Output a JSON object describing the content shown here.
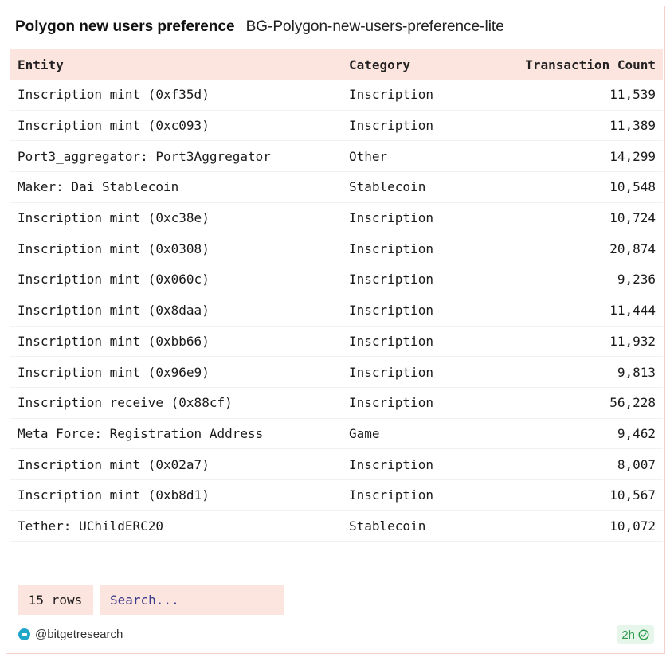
{
  "header": {
    "title": "Polygon new users preference",
    "subtitle": "BG-Polygon-new-users-preference-lite"
  },
  "table": {
    "columns": [
      "Entity",
      "Category",
      "Transaction Count"
    ],
    "rows": [
      [
        "Inscription mint (0xf35d)",
        "Inscription",
        "11,539"
      ],
      [
        "Inscription mint (0xc093)",
        "Inscription",
        "11,389"
      ],
      [
        "Port3_aggregator: Port3Aggregator",
        "Other",
        "14,299"
      ],
      [
        "Maker: Dai Stablecoin",
        "Stablecoin",
        "10,548"
      ],
      [
        "Inscription mint (0xc38e)",
        "Inscription",
        "10,724"
      ],
      [
        "Inscription mint (0x0308)",
        "Inscription",
        "20,874"
      ],
      [
        "Inscription mint (0x060c)",
        "Inscription",
        "9,236"
      ],
      [
        "Inscription mint (0x8daa)",
        "Inscription",
        "11,444"
      ],
      [
        "Inscription mint (0xbb66)",
        "Inscription",
        "11,932"
      ],
      [
        "Inscription mint (0x96e9)",
        "Inscription",
        "9,813"
      ],
      [
        "Inscription receive (0x88cf)",
        "Inscription",
        "56,228"
      ],
      [
        "Meta Force: Registration Address",
        "Game",
        "9,462"
      ],
      [
        "Inscription mint (0x02a7)",
        "Inscription",
        "8,007"
      ],
      [
        "Inscription mint (0xb8d1)",
        "Inscription",
        "10,567"
      ],
      [
        "Tether: UChildERC20",
        "Stablecoin",
        "10,072"
      ]
    ]
  },
  "footer": {
    "row_count": "15 rows",
    "search_placeholder": "Search...",
    "brand_handle": "@bitgetresearch",
    "freshness": "2h",
    "brand_icon": "bitget-logo-icon",
    "status_icon": "check-circle-icon"
  },
  "colors": {
    "accent_bg": "#fde5df",
    "border": "#f5cfc8",
    "fresh_green": "#2e9b4f",
    "brand_blue": "#1fa6c9"
  }
}
